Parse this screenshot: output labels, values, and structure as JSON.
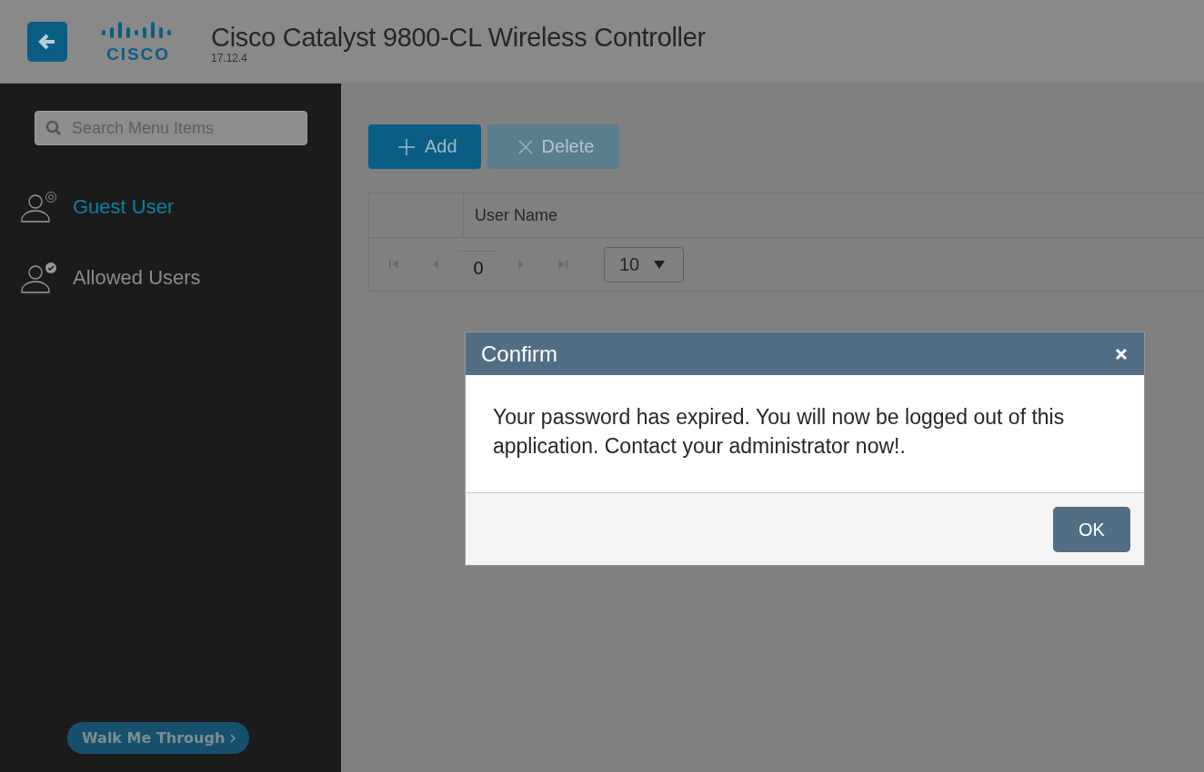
{
  "header": {
    "logo": "CISCO",
    "title": "Cisco Catalyst 9800-CL Wireless Controller",
    "version": "17.12.4"
  },
  "sidebar": {
    "search": {
      "placeholder": "Search Menu Items"
    },
    "items": [
      {
        "label": "Guest User",
        "kind": "gear",
        "selected": true
      },
      {
        "label": "Allowed Users",
        "kind": "check",
        "selected": false
      }
    ],
    "walk_me_through": "Walk Me Through"
  },
  "toolbar": [
    {
      "label": "Add",
      "kind": "add",
      "disabled": false
    },
    {
      "label": "Delete",
      "kind": "delete",
      "disabled": true
    }
  ],
  "table": {
    "columns": [
      "User Name"
    ],
    "pager": {
      "page": "0",
      "page_size": "10"
    }
  },
  "dialog": {
    "title": "Confirm",
    "message": "Your password has expired. You will now be logged out of this application. Contact your administrator now!.",
    "button": "OK"
  }
}
